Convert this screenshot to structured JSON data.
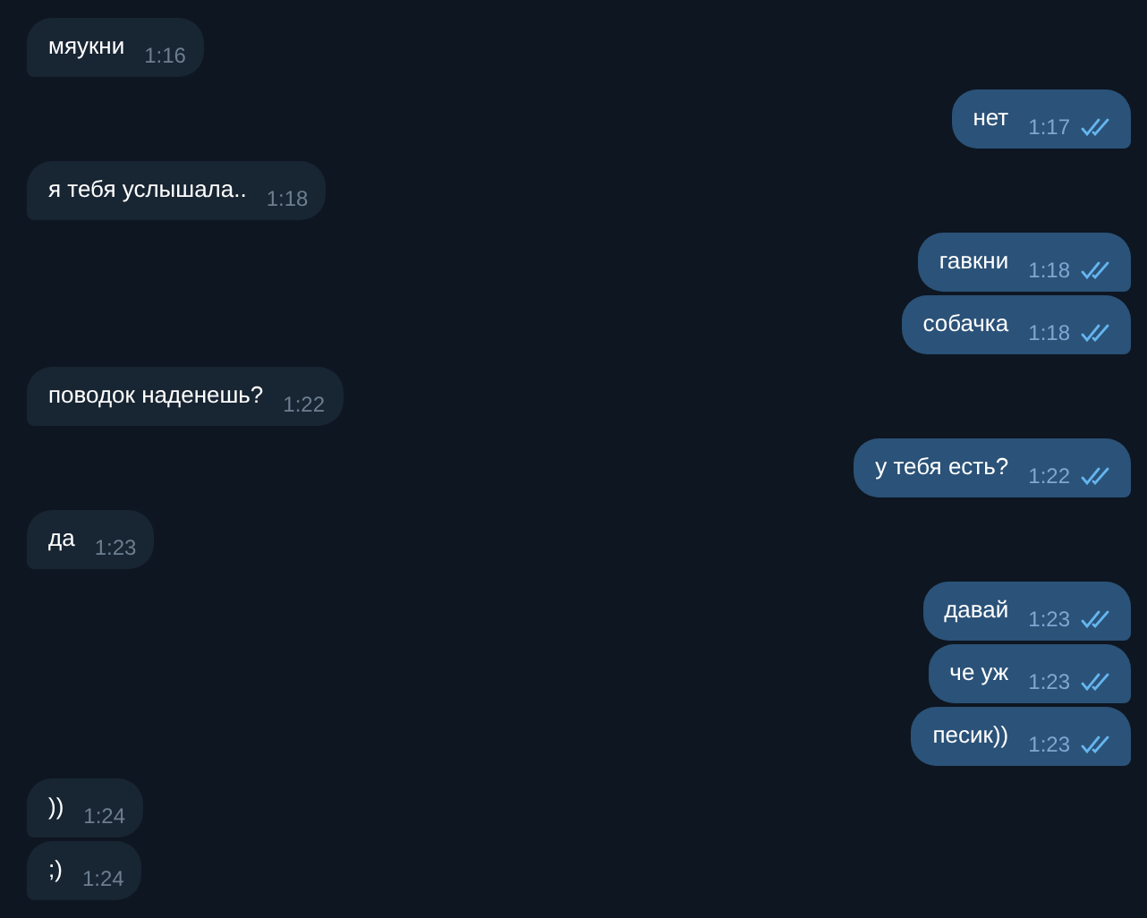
{
  "messages": [
    {
      "kind": "incoming",
      "text": "мяукни",
      "time": "1:16"
    },
    {
      "kind": "outgoing",
      "text": "нет",
      "time": "1:17",
      "read": true
    },
    {
      "kind": "incoming",
      "text": "я тебя услышала..",
      "time": "1:18"
    },
    {
      "kind": "outgoing",
      "text": "гавкни",
      "time": "1:18",
      "read": true
    },
    {
      "kind": "outgoing",
      "text": "собачка",
      "time": "1:18",
      "read": true
    },
    {
      "kind": "incoming",
      "text": "поводок наденешь?",
      "time": "1:22"
    },
    {
      "kind": "outgoing",
      "text": "у тебя есть?",
      "time": "1:22",
      "read": true
    },
    {
      "kind": "incoming",
      "text": "да",
      "time": "1:23"
    },
    {
      "kind": "outgoing",
      "text": "давай",
      "time": "1:23",
      "read": true
    },
    {
      "kind": "outgoing",
      "text": "че уж",
      "time": "1:23",
      "read": true
    },
    {
      "kind": "outgoing",
      "text": "песик))",
      "time": "1:23",
      "read": true
    },
    {
      "kind": "incoming",
      "text": "))",
      "time": "1:24"
    },
    {
      "kind": "incoming",
      "text": ";)",
      "time": "1:24"
    }
  ]
}
